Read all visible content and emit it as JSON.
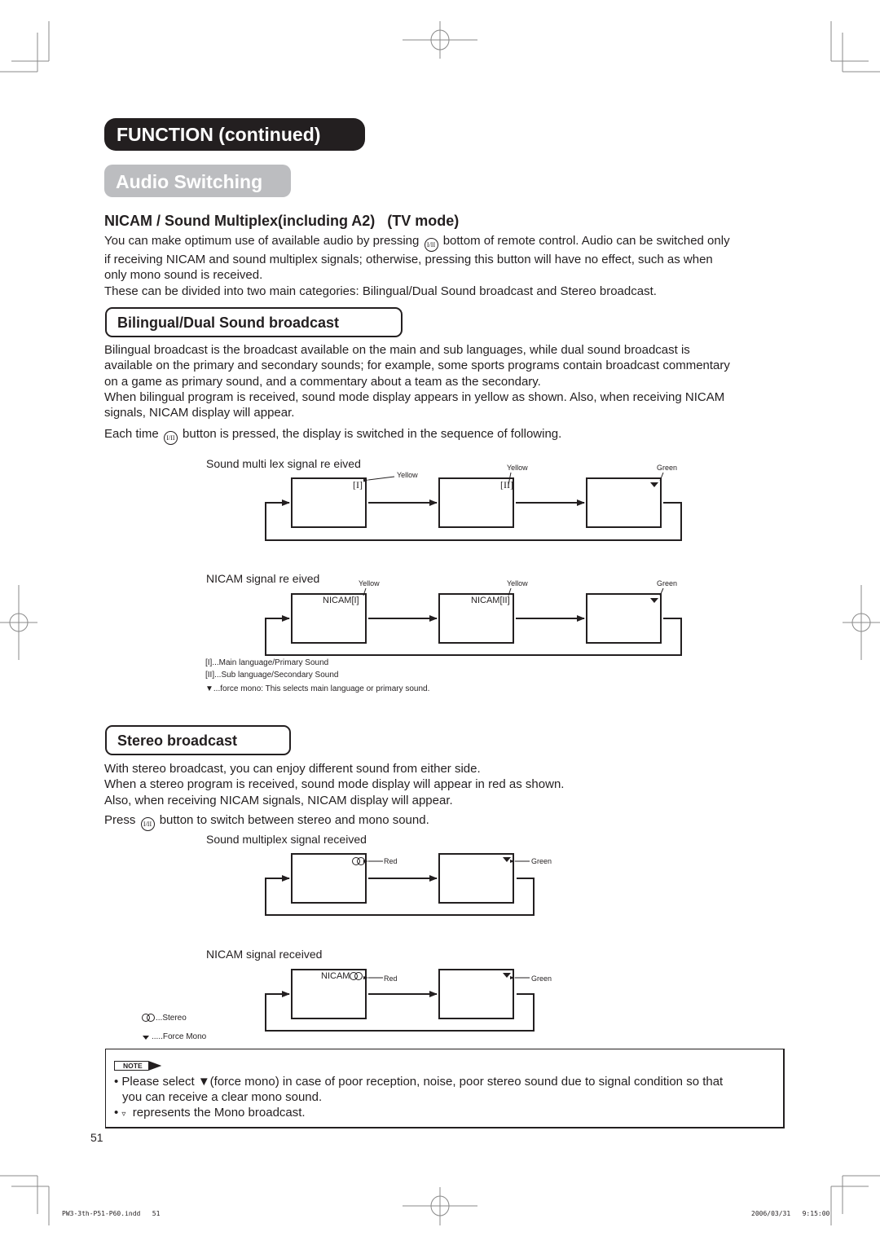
{
  "header": {
    "title": "FUNCTION (continued)",
    "section": "Audio Switching",
    "subtitle": "NICAM / Sound Multiplex(including A2)   (TV mode)"
  },
  "intro": {
    "line1_before": "You can make optimum use of available audio by pressing",
    "line1_after": "bottom of remote control.  Audio can be switched only",
    "line2": "if receiving NICAM and sound multiplex signals; otherwise, pressing this button will have no effect, such as when",
    "line3": "only mono sound is received.",
    "line4": "These can be divided into two main categories: Bilingual/Dual Sound broadcast and Stereo broadcast."
  },
  "button_icon_text": "I/II",
  "bilingual": {
    "heading": "Bilingual/Dual Sound broadcast",
    "p1": "Bilingual broadcast is the broadcast available on the main and sub languages, while dual sound broadcast is",
    "p2": "available on the primary and secondary sounds; for example, some sports programs contain broadcast commentary",
    "p3": "on a game as primary sound, and a commentary about a team as the secondary.",
    "p4": "When bilingual program is received, sound mode display appears in yellow as shown. Also, when receiving NICAM",
    "p5": "signals, NICAM display will appear.",
    "each_before": "Each time",
    "each_after": "button is pressed, the display is switched in the sequence of following.",
    "diagram1": {
      "label": "Sound multi  lex signal re  eived",
      "screens": [
        {
          "indicator": "[I]",
          "color_label": "Yellow"
        },
        {
          "indicator": "[II]",
          "color_label": "Yellow"
        },
        {
          "indicator": "▼",
          "color_label": "Green"
        }
      ]
    },
    "diagram2": {
      "label": "NICAM signal re  eived",
      "screens": [
        {
          "indicator": "NICAM[I]",
          "color_label": "Yellow"
        },
        {
          "indicator": "NICAM[II]",
          "color_label": "Yellow"
        },
        {
          "indicator": "▼",
          "color_label": "Green"
        }
      ]
    },
    "legend": [
      "[I]...Main language/Primary Sound",
      "[II]...Sub language/Secondary Sound",
      "▼...force mono: This selects main language or primary sound."
    ]
  },
  "stereo": {
    "heading": "Stereo broadcast",
    "p1": "With stereo broadcast, you can enjoy different sound from either side.",
    "p2": "When a stereo program is received, sound mode display will appear in red as shown.",
    "p3": "Also, when receiving NICAM signals, NICAM display will appear.",
    "press_before": "Press",
    "press_after": "button to switch between stereo and mono sound.",
    "diagram1": {
      "label": "Sound multiplex signal received",
      "screens": [
        {
          "indicator": "stereo",
          "color_label": "Red"
        },
        {
          "indicator": "▼",
          "color_label": "Green"
        }
      ]
    },
    "diagram2": {
      "label": "NICAM signal received",
      "screens": [
        {
          "indicator": "NICAM",
          "color_label": "Red"
        },
        {
          "indicator": "▼",
          "color_label": "Green"
        }
      ]
    },
    "legend": [
      "...Stereo",
      ".....Force Mono"
    ]
  },
  "note": {
    "tag": "NOTE",
    "bullet1_before": "Please select ",
    "bullet1_symbol": "▼",
    "bullet1_after": "(force mono) in case of poor reception, noise, poor stereo sound due to signal condition so that",
    "bullet1_cont": "you can receive a clear mono sound.",
    "bullet2_symbol": "▿",
    "bullet2_text": "represents the Mono broadcast."
  },
  "page_number": "51",
  "slug": {
    "file": "PW3-3th-P51-P60.indd   51",
    "timestamp": "2006/03/31   9:15:00"
  }
}
